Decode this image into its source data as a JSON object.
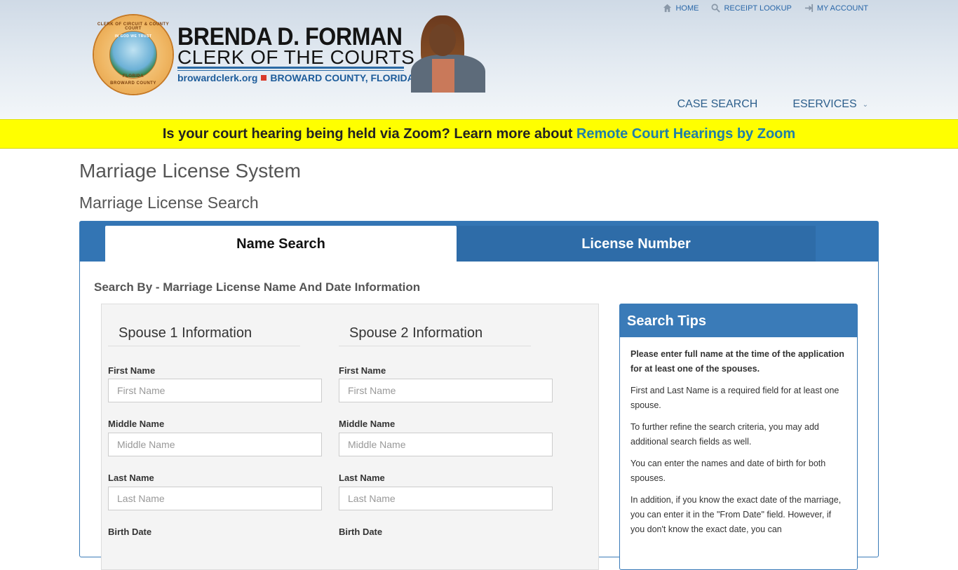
{
  "top_links": [
    {
      "label": "HOME",
      "icon": "home-icon"
    },
    {
      "label": "RECEIPT LOOKUP",
      "icon": "search-icon"
    },
    {
      "label": "MY ACCOUNT",
      "icon": "sign-in-icon"
    }
  ],
  "brand": {
    "name": "BRENDA D. FORMAN",
    "title": "CLERK OF THE COURTS",
    "website": "browardclerk.org",
    "county": "BROWARD COUNTY, FLORIDA",
    "seal_top": "CLERK OF CIRCUIT & COUNTY COURT",
    "seal_motto": "IN GOD WE TRUST",
    "seal_state": "FLORIDA",
    "seal_bottom": "BROWARD COUNTY"
  },
  "nav": {
    "case_search": "CASE SEARCH",
    "eservices": "ESERVICES"
  },
  "banner": {
    "text": "Is your court hearing being held via Zoom? Learn more about ",
    "link": "Remote Court Hearings by Zoom"
  },
  "page": {
    "title": "Marriage License System",
    "subtitle": "Marriage License Search"
  },
  "tabs": {
    "name_search": "Name Search",
    "license_number": "License Number"
  },
  "form": {
    "search_by": "Search By - Marriage License Name And Date Information",
    "spouse1_heading": "Spouse 1 Information",
    "spouse2_heading": "Spouse 2 Information",
    "first_name_label": "First Name",
    "first_name_placeholder": "First Name",
    "middle_name_label": "Middle Name",
    "middle_name_placeholder": "Middle Name",
    "last_name_label": "Last Name",
    "last_name_placeholder": "Last Name",
    "birth_date_label": "Birth Date"
  },
  "tips": {
    "heading": "Search Tips",
    "p1": "Please enter full name at the time of the application for at least one of the spouses.",
    "p2": "First and Last Name is a required field for at least one spouse.",
    "p3": "To further refine the search criteria, you may add additional search fields as well.",
    "p4": "You can enter the names and date of birth for both spouses.",
    "p5": "In addition, if you know the exact date of the marriage, you can enter it in the \"From Date\" field. However, if you don't know the exact date, you can"
  }
}
